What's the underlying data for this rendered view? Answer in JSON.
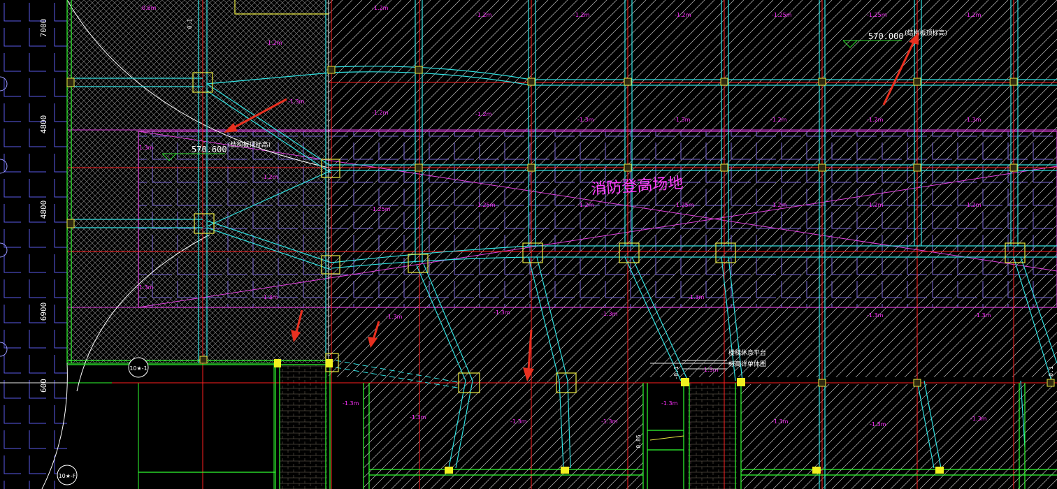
{
  "drawing": {
    "background": "#000000",
    "colors": {
      "grid_red": "#ff2020",
      "column_cyan": "#30e0e0",
      "purple_zone": "#e040e0",
      "hatch": "#d8d8d8",
      "hatch_dark": "#8a8a8a",
      "wall_green": "#30ff30",
      "column_yellow": "#e8e840",
      "label_magenta": "#ff30ff",
      "tile_blue": "#6a6aff",
      "arrow_red": "#e83020",
      "white": "#ffffff"
    }
  },
  "dimensions_left": [
    "7000",
    "4800",
    "4800",
    "6900",
    "600"
  ],
  "elevation_labels": [
    {
      "id": "elev-top-right",
      "value": "570.000",
      "note": "(结构板顶标高)"
    },
    {
      "id": "elev-left",
      "value": "570.600",
      "note": "(结构板顶标高)"
    }
  ],
  "zone_title": "消防登高场地",
  "platform_note": [
    "楼梯休息平台",
    "标高详单体图"
  ],
  "grid_markers": [
    "10★-1",
    "10★-F"
  ],
  "slab_marks": [
    "-0.8m",
    "-1.2m",
    "-1.2m",
    "-1.2m",
    "-1.2m",
    "-1.2m",
    "-1.25m",
    "-1.25m",
    "-1.2m",
    "-1.2m",
    "-1.2m",
    "-1.3m",
    "-1.3m",
    "-1.2m",
    "-1.2m",
    "-1.3m",
    "-1.3m",
    "-1.3m"
  ],
  "level_ticks": [
    "0.1",
    "-0.1",
    "-0.1",
    "0.1",
    "0.85"
  ],
  "arrows": [
    {
      "id": "arrow-1",
      "target": "elev-left"
    },
    {
      "id": "arrow-2",
      "target": "elev-top-right"
    },
    {
      "id": "arrow-3",
      "target": "wall-edge"
    },
    {
      "id": "arrow-4",
      "target": "wall-edge"
    },
    {
      "id": "arrow-5",
      "target": "wall-edge"
    }
  ]
}
